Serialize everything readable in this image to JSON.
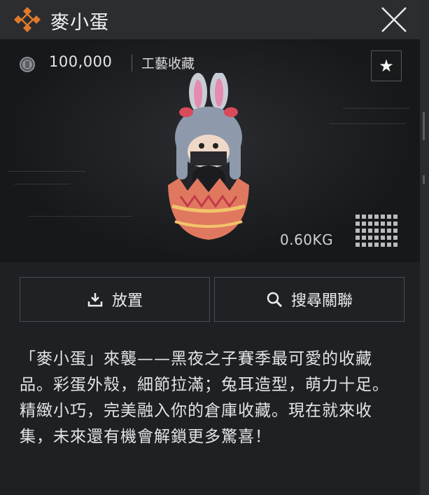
{
  "header": {
    "title": "麥小蛋",
    "logo_icon": "orange-diamond-logo-icon",
    "close_icon": "close-icon",
    "accent": "#e07a2a"
  },
  "item": {
    "price": "100,000",
    "currency_icon": "coin-icon",
    "category": "工藝收藏",
    "favorite_icon": "star-icon",
    "weight": "0.60KG",
    "size_icon": "grid-size-icon"
  },
  "actions": {
    "place_label": "放置",
    "search_label": "搜尋關聯"
  },
  "description": "「麥小蛋」來襲——黑夜之子賽季最可愛的收藏品。彩蛋外殼，細節拉滿；兔耳造型，萌力十足。精緻小巧，完美融入你的倉庫收藏。現在就來收集，未來還有機會解鎖更多驚喜！"
}
